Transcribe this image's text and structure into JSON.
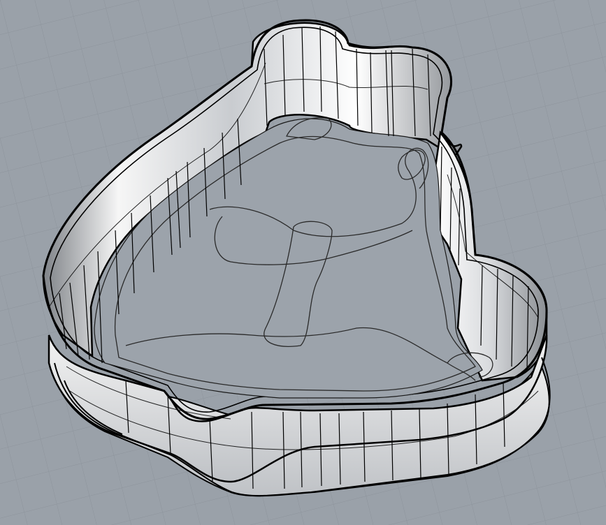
{
  "viewport": {
    "background_color": "#9aa1a9",
    "grid_color": "#8c939b",
    "object_edge_color": "#000000",
    "surface_light_color": "#f4f4f4",
    "surface_dark_color": "#7b7f84"
  },
  "object": {
    "icon": "curved-pool-mold-icon"
  }
}
